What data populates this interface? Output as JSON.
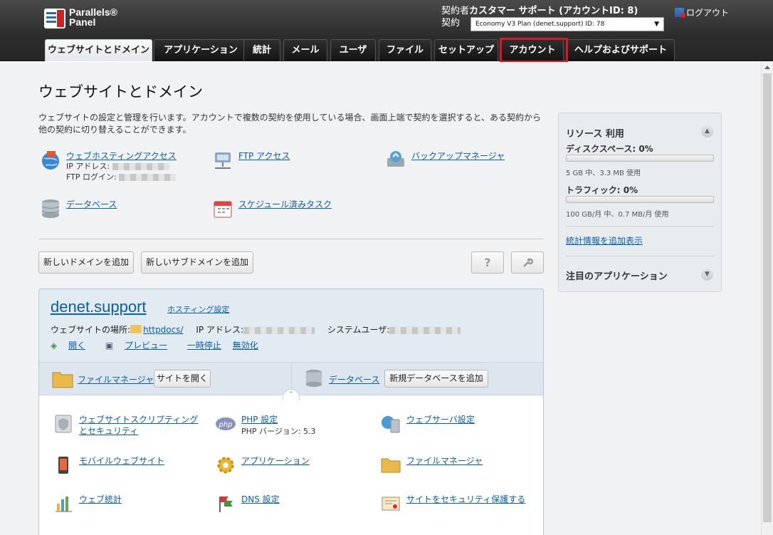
{
  "header": {
    "logo_line1": "Parallels®",
    "logo_line2": "Panel",
    "subscriber_label": "契約者",
    "subscriber_name": "カスタマー サポート (アカウントID: 8)",
    "subscription_label": "契約",
    "subscription_value": "Economy V3 Plan (denet.support) ID: 78",
    "logout": "ログアウト"
  },
  "tabs": [
    {
      "label": "ウェブサイトとドメイン",
      "active": true
    },
    {
      "label": "アプリケーション"
    },
    {
      "label": "統計"
    },
    {
      "label": "メール"
    },
    {
      "label": "ユーザ"
    },
    {
      "label": "ファイル"
    },
    {
      "label": "セットアップ"
    },
    {
      "label": "アカウント",
      "highlighted": true
    },
    {
      "label": "ヘルプおよびサポート"
    }
  ],
  "page": {
    "title": "ウェブサイトとドメイン",
    "intro": "ウェブサイトの設定と管理を行います。アカウントで複数の契約を使用している場合、画面上端で契約を選択すると、ある契約から他の契約に切り替えることができます。"
  },
  "tools": {
    "hosting_access": "ウェブホスティングアクセス",
    "ip_label": "IP アドレス:",
    "ftp_login_label": "FTP ログイン:",
    "ftp_access": "FTP アクセス",
    "backup": "バックアップマネージャ",
    "databases": "データベース",
    "scheduled_tasks": "スケジュール済みタスク"
  },
  "buttons": {
    "add_domain": "新しいドメインを追加",
    "add_subdomain": "新しいサブドメインを追加",
    "help": "?"
  },
  "domain": {
    "name": "denet.support",
    "hosting_settings": "ホスティング設定",
    "location_label": "ウェブサイトの場所:",
    "docroot": "httpdocs/",
    "ip_label": "IP アドレス:",
    "sysuser_label": "システムユーザ:",
    "actions": {
      "open": "開く",
      "preview": "プレビュー",
      "suspend": "一時停止",
      "disable": "無効化"
    },
    "file_manager": "ファイルマネージャ",
    "open_site": "サイトを開く",
    "databases": "データベース",
    "add_database": "新規データベースを追加"
  },
  "features": {
    "scripting": "ウェブサイトスクリプティングとセキュリティ",
    "php": "PHP 設定",
    "php_version": "PHP バージョン: 5.3",
    "webserver": "ウェブサーバ設定",
    "mobile": "モバイルウェブサイト",
    "applications": "アプリケーション",
    "file_manager": "ファイルマネージャ",
    "web_stats": "ウェブ統計",
    "dns": "DNS 設定",
    "secure": "サイトをセキュリティ保護する"
  },
  "sidebar": {
    "resources_title": "リソース 利用",
    "disk_label": "ディスクスペース: 0%",
    "disk_usage": "5 GB 中、3.3 MB 使用",
    "disk_fraction": 0.0,
    "traffic_label": "トラフィック: 0%",
    "traffic_usage": "100 GB/月 中、0.7 MB/月 使用",
    "traffic_fraction": 0.0,
    "more_stats": "統計情報を追加表示",
    "featured_title": "注目のアプリケーション"
  },
  "colors": {
    "link": "#0b5ea8",
    "highlight": "#e3141d",
    "header_bg": "#2c2c2c"
  }
}
